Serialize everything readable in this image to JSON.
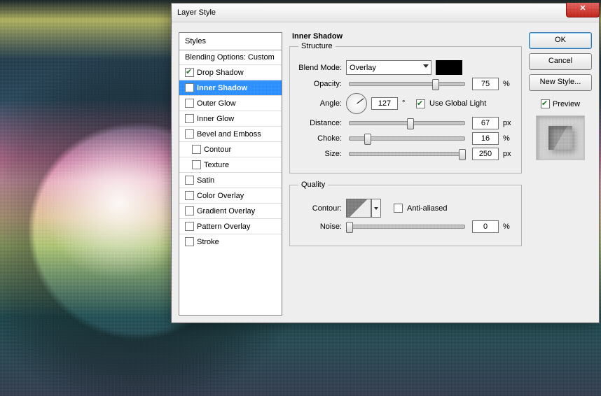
{
  "window": {
    "title": "Layer Style"
  },
  "sidebar": {
    "header": "Styles",
    "blending_label": "Blending Options: Custom",
    "items": [
      {
        "label": "Drop Shadow",
        "checked": true,
        "sub": false
      },
      {
        "label": "Inner Shadow",
        "checked": true,
        "sub": false,
        "selected": true
      },
      {
        "label": "Outer Glow",
        "checked": false,
        "sub": false
      },
      {
        "label": "Inner Glow",
        "checked": false,
        "sub": false
      },
      {
        "label": "Bevel and Emboss",
        "checked": false,
        "sub": false
      },
      {
        "label": "Contour",
        "checked": false,
        "sub": true
      },
      {
        "label": "Texture",
        "checked": false,
        "sub": true
      },
      {
        "label": "Satin",
        "checked": false,
        "sub": false
      },
      {
        "label": "Color Overlay",
        "checked": false,
        "sub": false
      },
      {
        "label": "Gradient Overlay",
        "checked": false,
        "sub": false
      },
      {
        "label": "Pattern Overlay",
        "checked": false,
        "sub": false
      },
      {
        "label": "Stroke",
        "checked": false,
        "sub": false
      }
    ]
  },
  "panel": {
    "title": "Inner Shadow",
    "structure": {
      "legend": "Structure",
      "blend_mode_label": "Blend Mode:",
      "blend_mode_value": "Overlay",
      "color_swatch": "#000000",
      "opacity_label": "Opacity:",
      "opacity_value": "75",
      "opacity_unit": "%",
      "angle_label": "Angle:",
      "angle_value": "127",
      "angle_unit": "°",
      "global_light_checked": true,
      "global_light_label": "Use Global Light",
      "distance_label": "Distance:",
      "distance_value": "67",
      "distance_unit": "px",
      "choke_label": "Choke:",
      "choke_value": "16",
      "choke_unit": "%",
      "size_label": "Size:",
      "size_value": "250",
      "size_unit": "px"
    },
    "quality": {
      "legend": "Quality",
      "contour_label": "Contour:",
      "anti_aliased_checked": false,
      "anti_aliased_label": "Anti-aliased",
      "noise_label": "Noise:",
      "noise_value": "0",
      "noise_unit": "%"
    }
  },
  "buttons": {
    "ok": "OK",
    "cancel": "Cancel",
    "new_style": "New Style...",
    "preview_label": "Preview",
    "preview_checked": true
  }
}
